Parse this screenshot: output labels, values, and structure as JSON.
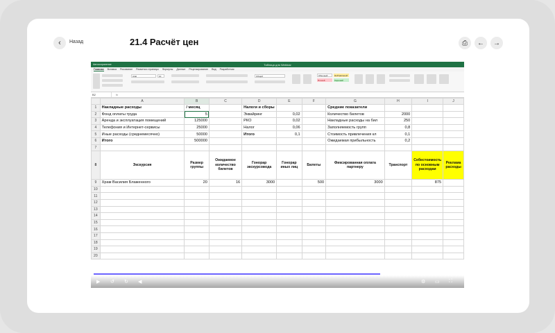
{
  "nav": {
    "back_label": "Назад"
  },
  "page": {
    "title": "21.4 Расчёт цен"
  },
  "excel": {
    "window_title": "Таблица для Webinar",
    "autosave": "Автосохранение",
    "tabs": [
      "Главная",
      "Вставка",
      "Рисование",
      "Разметка страницы",
      "Формулы",
      "Данные",
      "Рецензирование",
      "Вид",
      "Разработчик"
    ],
    "font_name": "Arial",
    "font_size": "10",
    "number_format": "Общий",
    "styles": [
      "Обычный",
      "Нейтральный",
      "Плохой",
      "Хороший"
    ],
    "name_box": "B2",
    "formula_icon": "fx",
    "col_headers": [
      "A",
      "B",
      "C",
      "D",
      "E",
      "F",
      "G",
      "H",
      "I",
      "J"
    ],
    "rows": [
      {
        "n": "1",
        "c": [
          "Накладные расходы",
          "/ месяц",
          "",
          "Налоги и сборы",
          "",
          "",
          "Средние показатели",
          "",
          "",
          ""
        ]
      },
      {
        "n": "2",
        "c": [
          "Фонд оплаты труда",
          "5",
          "",
          "Эквайринг",
          "0,02",
          "",
          "Количество билетов",
          "2000",
          "",
          ""
        ]
      },
      {
        "n": "3",
        "c": [
          "Аренда и эксплуатация помещений",
          "125000",
          "",
          "РКО",
          "0,02",
          "",
          "Накладные расходы на бил",
          "250",
          "",
          ""
        ]
      },
      {
        "n": "4",
        "c": [
          "Телефония и Интернет-сервисы",
          "25000",
          "",
          "Налог",
          "0,06",
          "",
          "Заполняемость групп",
          "0,8",
          "",
          ""
        ]
      },
      {
        "n": "5",
        "c": [
          "Иные расходы (среднемесячно)",
          "50000",
          "",
          "Итого",
          "0,1",
          "",
          "Стоимость привлечения кл",
          "0,1",
          "",
          ""
        ]
      },
      {
        "n": "6",
        "c": [
          "Итого",
          "500000",
          "",
          "",
          "",
          "",
          "Ожидаемая прибыльность",
          "0,2",
          "",
          ""
        ]
      },
      {
        "n": "7",
        "c": [
          "",
          "",
          "",
          "",
          "",
          "",
          "",
          "",
          "",
          ""
        ]
      },
      {
        "n": "8",
        "c": [
          "Экскурсия",
          "Размер группы",
          "Ожидаемое количество билетов",
          "Гонорар экскурсовода",
          "Гонорар иных лиц",
          "Билеты",
          "Фиксированная оплата партнеру",
          "Транспорт",
          "Себестоимость по основным расходам",
          "Реклама расходы"
        ]
      },
      {
        "n": "9",
        "c": [
          "Храм Василия Блаженного",
          "20",
          "16",
          "3000",
          "",
          "500",
          "3000",
          "",
          "875",
          ""
        ]
      },
      {
        "n": "10",
        "c": [
          "",
          "",
          "",
          "",
          "",
          "",
          "",
          "",
          "",
          ""
        ]
      },
      {
        "n": "11",
        "c": [
          "",
          "",
          "",
          "",
          "",
          "",
          "",
          "",
          "",
          ""
        ]
      },
      {
        "n": "12",
        "c": [
          "",
          "",
          "",
          "",
          "",
          "",
          "",
          "",
          "",
          ""
        ]
      },
      {
        "n": "13",
        "c": [
          "",
          "",
          "",
          "",
          "",
          "",
          "",
          "",
          "",
          ""
        ]
      },
      {
        "n": "14",
        "c": [
          "",
          "",
          "",
          "",
          "",
          "",
          "",
          "",
          "",
          ""
        ]
      },
      {
        "n": "15",
        "c": [
          "",
          "",
          "",
          "",
          "",
          "",
          "",
          "",
          "",
          ""
        ]
      },
      {
        "n": "16",
        "c": [
          "",
          "",
          "",
          "",
          "",
          "",
          "",
          "",
          "",
          ""
        ]
      },
      {
        "n": "17",
        "c": [
          "",
          "",
          "",
          "",
          "",
          "",
          "",
          "",
          "",
          ""
        ]
      },
      {
        "n": "18",
        "c": [
          "",
          "",
          "",
          "",
          "",
          "",
          "",
          "",
          "",
          ""
        ]
      },
      {
        "n": "19",
        "c": [
          "",
          "",
          "",
          "",
          "",
          "",
          "",
          "",
          "",
          ""
        ]
      },
      {
        "n": "20",
        "c": [
          "",
          "",
          "",
          "",
          "",
          "",
          "",
          "",
          "",
          ""
        ]
      }
    ]
  },
  "video": {
    "progress": 0.78
  }
}
